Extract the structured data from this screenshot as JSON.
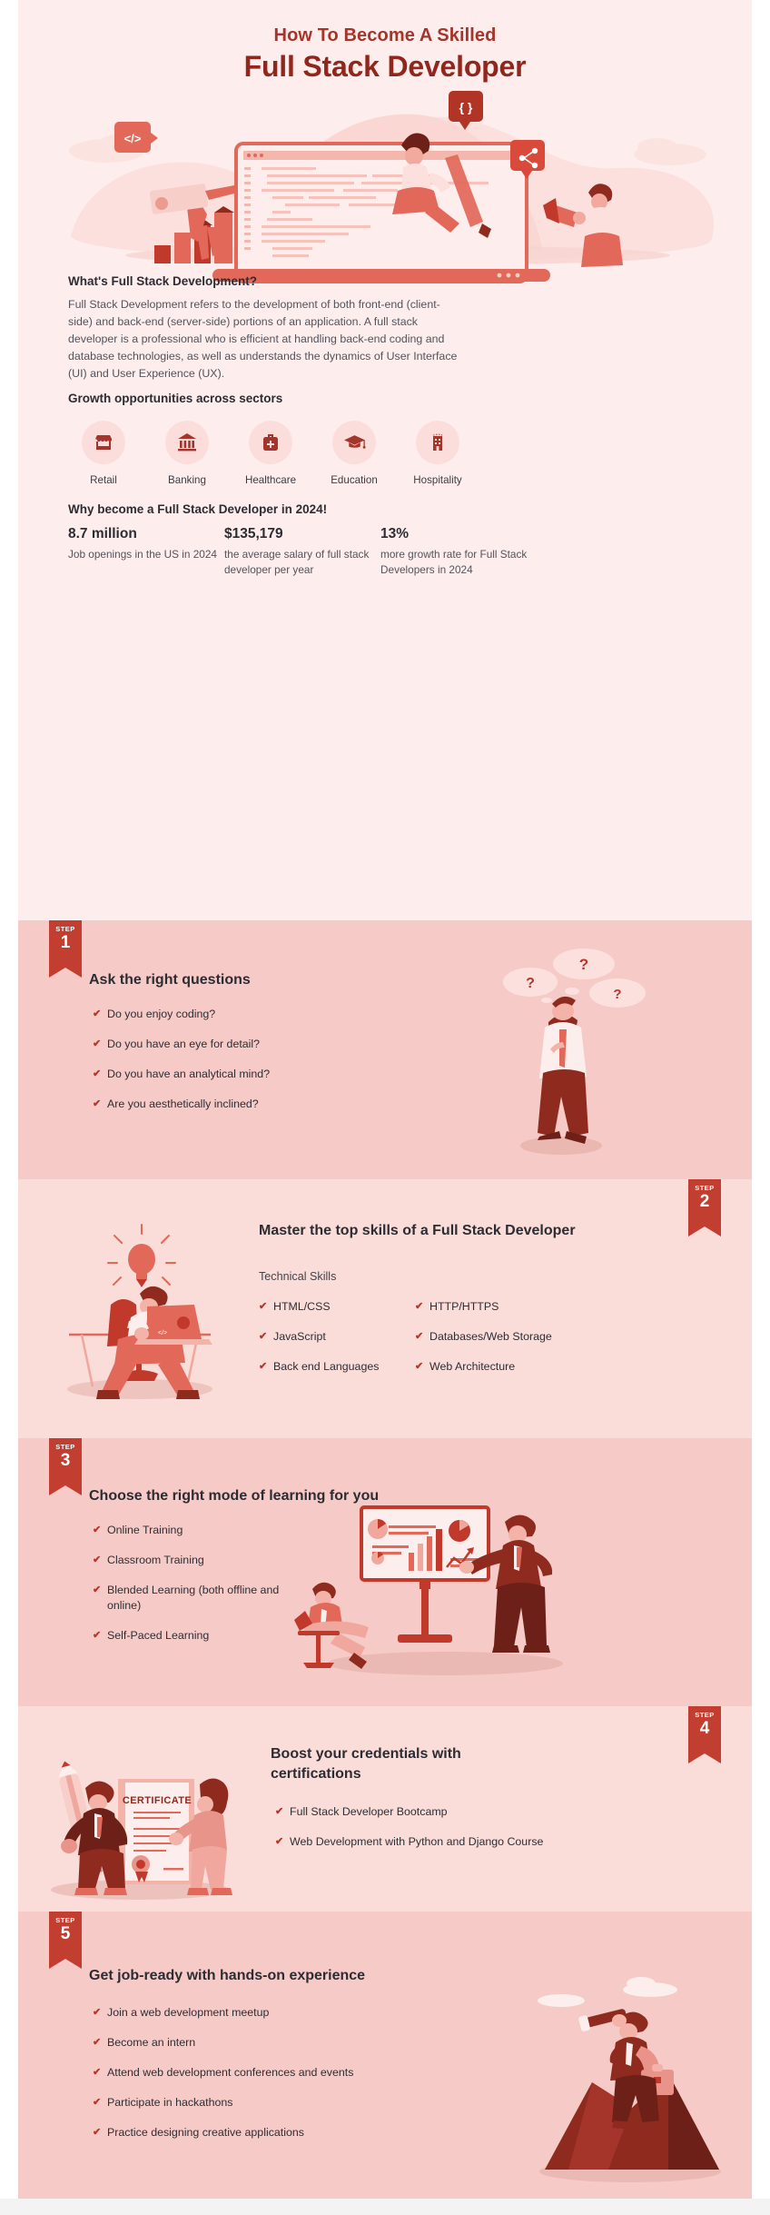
{
  "hero": {
    "kicker": "How To Become A Skilled",
    "title": "Full Stack Developer",
    "code_badge_1": "</>",
    "code_badge_2": "{ }",
    "share_badge": "share-icon"
  },
  "about": {
    "heading": "What's Full Stack Development?",
    "paragraph": "Full Stack Development refers to the development of both front-end (client-side) and back-end (server-side) portions of an application. A full stack developer is a professional who is efficient at handling back-end coding and database technologies, as well as understands the dynamics of User Interface (UI) and User Experience (UX)."
  },
  "growth": {
    "heading": "Growth opportunities across sectors",
    "sectors": [
      {
        "label": "Retail",
        "icon": "store-icon"
      },
      {
        "label": "Banking",
        "icon": "bank-icon"
      },
      {
        "label": "Healthcare",
        "icon": "medical-bag-icon"
      },
      {
        "label": "Education",
        "icon": "graduation-cap-icon"
      },
      {
        "label": "Hospitality",
        "icon": "hotel-icon"
      }
    ]
  },
  "why": {
    "heading": "Why become a Full Stack Developer in 2024!",
    "stats": [
      {
        "value": "8.7 million",
        "desc": "Job openings in the US in 2024"
      },
      {
        "value": "$135,179",
        "desc": "the average salary of full stack developer per year"
      },
      {
        "value": "13%",
        "desc": "more growth rate for Full Stack Developers in 2024"
      }
    ]
  },
  "steps": [
    {
      "label": "STEP",
      "number": "1",
      "title": "Ask the right questions",
      "items": [
        "Do you enjoy coding?",
        "Do you have an eye for detail?",
        "Do you have an analytical mind?",
        "Are you aesthetically inclined?"
      ],
      "illustration": "thinking-person-with-question-bubbles"
    },
    {
      "label": "STEP",
      "number": "2",
      "title": "Master the top skills of a Full Stack Developer",
      "subtitle": "Technical Skills",
      "items_left": [
        "HTML/CSS",
        "JavaScript",
        "Back end Languages"
      ],
      "items_right": [
        "HTTP/HTTPS",
        "Databases/Web Storage",
        "Web Architecture"
      ],
      "illustration": "developer-at-desk-with-lightbulb"
    },
    {
      "label": "STEP",
      "number": "3",
      "title": "Choose the right mode of learning for you",
      "items": [
        "Online Training",
        "Classroom Training",
        "Blended Learning (both offline and online)",
        "Self-Paced Learning"
      ],
      "illustration": "presentation-whiteboard-with-charts"
    },
    {
      "label": "STEP",
      "number": "4",
      "title": "Boost your credentials with certifications",
      "items": [
        "Full Stack Developer Bootcamp",
        "Web Development with Python and Django Course"
      ],
      "illustration": "certificate-with-giant-pencil",
      "certificate_text": "CERTIFICATE"
    },
    {
      "label": "STEP",
      "number": "5",
      "title": "Get job-ready with hands-on experience",
      "items": [
        "Join a web development meetup",
        "Become an intern",
        "Attend web development conferences and events",
        "Participate in hackathons",
        "Practice designing creative applications"
      ],
      "illustration": "person-on-mountain-with-telescope"
    }
  ],
  "colors": {
    "brand_dark": "#91261d",
    "brand": "#c23e31",
    "accent": "#b8352a",
    "hero_bg": "#fdeeed",
    "step_bg_dark": "#f6cac6",
    "step_bg_light": "#fadcd8",
    "text": "#2c2c33",
    "text_muted": "#53535b"
  }
}
